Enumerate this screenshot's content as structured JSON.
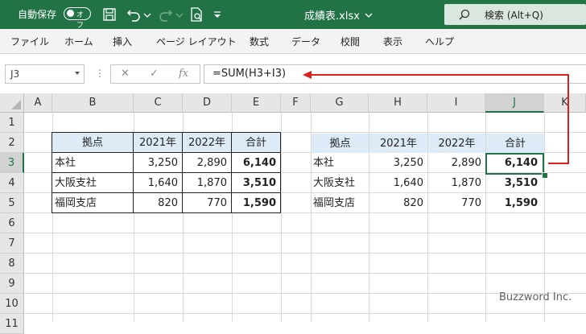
{
  "titlebar": {
    "autosave_label": "自動保存",
    "autosave_state": "オフ",
    "document_title": "成績表.xlsx",
    "search_label": "検索 (Alt+Q)",
    "bg_color": "#217346"
  },
  "ribbon": {
    "tabs": [
      "ファイル",
      "ホーム",
      "挿入",
      "ページ レイアウト",
      "数式",
      "データ",
      "校閲",
      "表示",
      "ヘルプ"
    ]
  },
  "formula_bar": {
    "name_box": "J3",
    "fx_label": "fx",
    "formula": "=SUM(H3+I3)",
    "annotation_color": "#d9201c"
  },
  "sheet": {
    "columns": [
      "A",
      "B",
      "C",
      "D",
      "E",
      "F",
      "G",
      "H",
      "I",
      "J",
      "K"
    ],
    "rows": [
      "1",
      "2",
      "3",
      "4",
      "5",
      "6",
      "7",
      "8",
      "9",
      "10",
      "11"
    ],
    "selected_cell": "J3",
    "table1": {
      "header": [
        "拠点",
        "2021年",
        "2022年",
        "合計"
      ],
      "rows": [
        [
          "本社",
          "3,250",
          "2,890",
          "6,140"
        ],
        [
          "大阪支社",
          "1,640",
          "1,870",
          "3,510"
        ],
        [
          "福岡支店",
          "820",
          "770",
          "1,590"
        ]
      ]
    },
    "table2": {
      "header": [
        "拠点",
        "2021年",
        "2022年",
        "合計"
      ],
      "rows": [
        [
          "本社",
          "3,250",
          "2,890",
          "6,140"
        ],
        [
          "大阪支社",
          "1,640",
          "1,870",
          "3,510"
        ],
        [
          "福岡支店",
          "820",
          "770",
          "1,590"
        ]
      ]
    }
  },
  "watermark": "Buzzword Inc."
}
